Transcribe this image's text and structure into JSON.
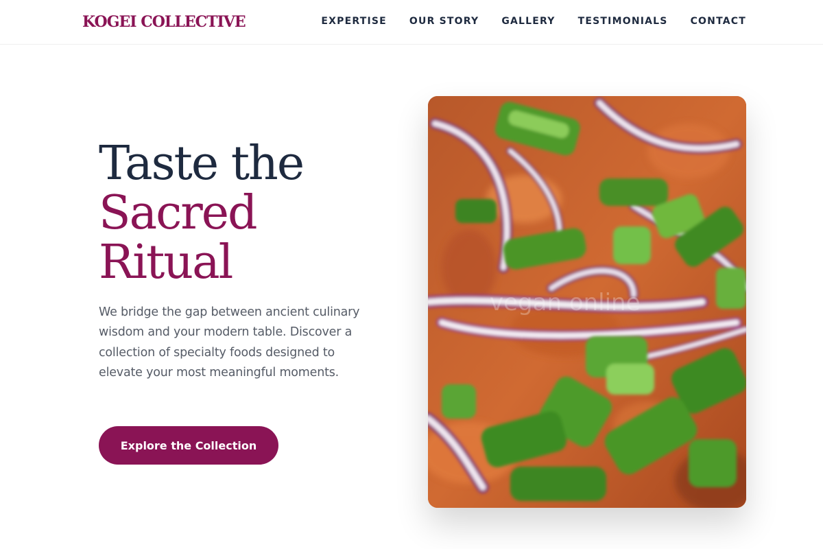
{
  "nav": {
    "brand": "KOGEI COLLECTIVE",
    "links": [
      "EXPERTISE",
      "OUR STORY",
      "GALLERY",
      "TESTIMONIALS",
      "CONTACT"
    ]
  },
  "hero": {
    "headline_line1": "Taste the",
    "headline_line2": "Sacred",
    "headline_line3": "Ritual",
    "description": "We bridge the gap between ancient culinary wisdom and your modern table. Discover a collection of specialty foods designed to elevate your most meaningful moments.",
    "cta_label": "Explore the Collection"
  },
  "colors": {
    "accent": "#8a1455",
    "text_dark": "#1e2a3f",
    "text_muted": "#555b66"
  },
  "image": {
    "subject": "close-up of food topped with sliced red onion and green onion",
    "watermark": "vegan online"
  }
}
